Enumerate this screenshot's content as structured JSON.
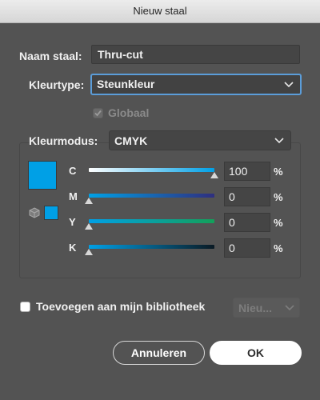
{
  "window": {
    "title": "Nieuw staal"
  },
  "name_field": {
    "label": "Naam staal:",
    "value": "Thru-cut"
  },
  "color_type": {
    "label": "Kleurtype:",
    "selected": "Steunkleur"
  },
  "global": {
    "label": "Globaal",
    "checked": true,
    "enabled": false
  },
  "color_mode": {
    "label": "Kleurmodus:",
    "selected": "CMYK"
  },
  "swatch_color": "#00a0e6",
  "channels": [
    {
      "key": "c",
      "label": "C",
      "value": "100",
      "unit": "%",
      "level": 100
    },
    {
      "key": "m",
      "label": "M",
      "value": "0",
      "unit": "%",
      "level": 0
    },
    {
      "key": "y",
      "label": "Y",
      "value": "0",
      "unit": "%",
      "level": 0
    },
    {
      "key": "k",
      "label": "K",
      "value": "0",
      "unit": "%",
      "level": 0
    }
  ],
  "library": {
    "label": "Toevoegen aan mijn bibliotheek",
    "checked": false,
    "dropdown": "Nieu..."
  },
  "buttons": {
    "cancel": "Annuleren",
    "ok": "OK"
  },
  "colors": {
    "accent": "#5b9dd9",
    "dialog_bg": "#535353",
    "cyan": "#00a0e6"
  }
}
